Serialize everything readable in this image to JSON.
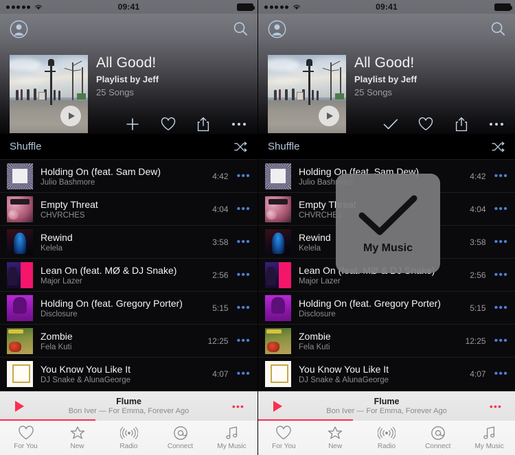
{
  "status_bar": {
    "carrier_dots": 5,
    "time": "09:41",
    "wifi_icon": "wifi-icon",
    "battery_icon": "battery-full-icon"
  },
  "header": {
    "profile_icon": "profile-icon",
    "search_icon": "search-icon",
    "artwork_alt": "playlist-artwork-paris-viewpoint",
    "play_icon": "play-icon",
    "title": "All Good!",
    "subtitle": "Playlist by Jeff",
    "song_count": "25 Songs",
    "actions_left": [
      {
        "name": "add-button",
        "icon": "plus-icon"
      },
      {
        "name": "love-button",
        "icon": "heart-icon"
      },
      {
        "name": "share-button",
        "icon": "share-icon"
      },
      {
        "name": "more-button",
        "icon": "ellipsis-icon"
      }
    ],
    "actions_right": [
      {
        "name": "added-button",
        "icon": "checkmark-icon"
      },
      {
        "name": "love-button",
        "icon": "heart-icon"
      },
      {
        "name": "share-button",
        "icon": "share-icon"
      },
      {
        "name": "more-button",
        "icon": "ellipsis-icon"
      }
    ]
  },
  "shuffle": {
    "label": "Shuffle",
    "icon": "shuffle-icon"
  },
  "tracks": [
    {
      "title": "Holding On (feat. Sam Dew)",
      "artist": "Julio Bashmore",
      "duration": "4:42",
      "art": "art-holding"
    },
    {
      "title": "Empty Threat",
      "artist": "CHVRCHES",
      "duration": "4:04",
      "art": "art-empty"
    },
    {
      "title": "Rewind",
      "artist": "Kelela",
      "duration": "3:58",
      "art": "art-rewind"
    },
    {
      "title": "Lean On (feat. MØ & DJ Snake)",
      "artist": "Major Lazer",
      "duration": "2:56",
      "art": "art-lean"
    },
    {
      "title": "Holding On (feat. Gregory Porter)",
      "artist": "Disclosure",
      "duration": "5:15",
      "art": "art-disclosure"
    },
    {
      "title": "Zombie",
      "artist": "Fela Kuti",
      "duration": "12:25",
      "art": "art-zombie"
    },
    {
      "title": "You Know You Like It",
      "artist": "DJ Snake & AlunaGeorge",
      "duration": "4:07",
      "art": "art-know"
    }
  ],
  "track_more_label": "•••",
  "now_playing": {
    "play_icon": "play-icon",
    "title": "Flume",
    "subtitle": "Bon Iver — For Emma, Forever Ago",
    "more_label": "•••",
    "progress_percent": 37
  },
  "tab_bar": {
    "items": [
      {
        "label": "For You",
        "icon": "heart-icon",
        "name": "tab-for-you"
      },
      {
        "label": "New",
        "icon": "star-icon",
        "name": "tab-new"
      },
      {
        "label": "Radio",
        "icon": "radio-icon",
        "name": "tab-radio"
      },
      {
        "label": "Connect",
        "icon": "at-icon",
        "name": "tab-connect"
      },
      {
        "label": "My Music",
        "icon": "music-note-icon",
        "name": "tab-my-music"
      }
    ]
  },
  "hud_overlay": {
    "icon": "checkmark-icon",
    "label": "My Music"
  },
  "colors": {
    "accent_pink": "#fa2e51",
    "accent_blue": "#4e7fd4",
    "shuffle_blue": "#b4c6da",
    "background": "#000000",
    "hud_background": "#7c7c7e"
  }
}
